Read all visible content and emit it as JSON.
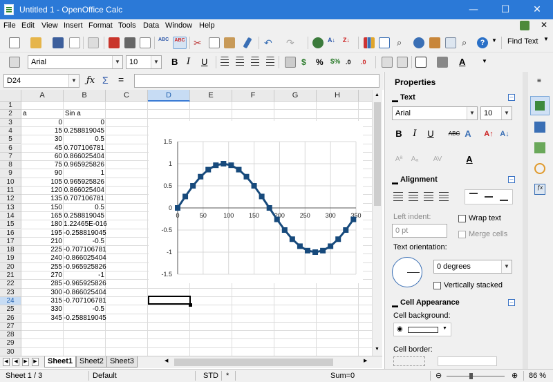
{
  "window": {
    "title": "Untitled 1 - OpenOffice Calc",
    "minimize_glyph": "—",
    "maximize_glyph": "☐",
    "close_glyph": "✕"
  },
  "menu": [
    {
      "label": "File"
    },
    {
      "label": "Edit"
    },
    {
      "label": "View"
    },
    {
      "label": "Insert"
    },
    {
      "label": "Format"
    },
    {
      "label": "Tools"
    },
    {
      "label": "Data"
    },
    {
      "label": "Window"
    },
    {
      "label": "Help"
    }
  ],
  "toolbar": {
    "find_text_label": "Find Text",
    "font_name": "Arial",
    "font_size": "10"
  },
  "formula_bar": {
    "name_box": "D24",
    "formula": ""
  },
  "grid": {
    "columns": [
      "A",
      "B",
      "C",
      "D",
      "E",
      "F",
      "G",
      "H"
    ],
    "active_column": "D",
    "rows": [
      "1",
      "2",
      "3",
      "4",
      "5",
      "6",
      "7",
      "8",
      "9",
      "10",
      "11",
      "12",
      "13",
      "14",
      "15",
      "16",
      "17",
      "18",
      "19",
      "20",
      "21",
      "22",
      "23",
      "24",
      "25",
      "26",
      "27",
      "28",
      "29",
      "30"
    ],
    "active_row": "24",
    "header_a": "a",
    "header_b": "Sin a",
    "data": [
      [
        "0",
        "0"
      ],
      [
        "15",
        "0.258819045"
      ],
      [
        "30",
        "0.5"
      ],
      [
        "45",
        "0.707106781"
      ],
      [
        "60",
        "0.866025404"
      ],
      [
        "75",
        "0.965925826"
      ],
      [
        "90",
        "1"
      ],
      [
        "105",
        "0.965925826"
      ],
      [
        "120",
        "0.866025404"
      ],
      [
        "135",
        "0.707106781"
      ],
      [
        "150",
        "0.5"
      ],
      [
        "165",
        "0.258819045"
      ],
      [
        "180",
        "1.22465E-016"
      ],
      [
        "195",
        "-0.258819045"
      ],
      [
        "210",
        "-0.5"
      ],
      [
        "225",
        "-0.707106781"
      ],
      [
        "240",
        "-0.866025404"
      ],
      [
        "255",
        "-0.965925826"
      ],
      [
        "270",
        "-1"
      ],
      [
        "285",
        "-0.965925826"
      ],
      [
        "300",
        "-0.866025404"
      ],
      [
        "315",
        "-0.707106781"
      ],
      [
        "330",
        "-0.5"
      ],
      [
        "345",
        "-0.258819045"
      ]
    ]
  },
  "chart_data": {
    "type": "line",
    "title": "",
    "xlabel": "",
    "ylabel": "",
    "x": [
      0,
      15,
      30,
      45,
      60,
      75,
      90,
      105,
      120,
      135,
      150,
      165,
      180,
      195,
      210,
      225,
      240,
      255,
      270,
      285,
      300,
      315,
      330,
      345
    ],
    "series": [
      {
        "values": [
          0,
          0.258819045,
          0.5,
          0.707106781,
          0.866025404,
          0.965925826,
          1,
          0.965925826,
          0.866025404,
          0.707106781,
          0.5,
          0.258819045,
          0,
          -0.258819045,
          -0.5,
          -0.707106781,
          -0.866025404,
          -0.965925826,
          -1,
          -0.965925826,
          -0.866025404,
          -0.707106781,
          -0.5,
          -0.258819045
        ],
        "color": "#174a7c"
      }
    ],
    "xticks": [
      "0",
      "50",
      "100",
      "150",
      "200",
      "250",
      "300",
      "350"
    ],
    "yticks": [
      "1.5",
      "1",
      "0.5",
      "0",
      "-0.5",
      "-1",
      "-1.5"
    ],
    "xlim": [
      0,
      350
    ],
    "ylim": [
      -1.5,
      1.5
    ],
    "grid": true,
    "legend": "none"
  },
  "sheets": {
    "tabs": [
      "Sheet1",
      "Sheet2",
      "Sheet3"
    ],
    "active": "Sheet1"
  },
  "sidebar": {
    "title": "Properties",
    "text_section": "Text",
    "font_name": "Arial",
    "font_size": "10",
    "alignment_section": "Alignment",
    "left_indent_label": "Left indent:",
    "left_indent_value": "0 pt",
    "wrap_text_label": "Wrap text",
    "merge_cells_label": "Merge cells",
    "text_orientation_label": "Text orientation:",
    "orientation_value": "0 degrees",
    "vertically_stacked_label": "Vertically stacked",
    "cell_appearance_section": "Cell Appearance",
    "cell_background_label": "Cell background:",
    "cell_border_label": "Cell border:"
  },
  "status": {
    "sheet": "Sheet 1 / 3",
    "style": "Default",
    "mode": "STD",
    "modified": "*",
    "sum": "Sum=0",
    "zoom": "86 %"
  },
  "colors": {
    "titlebar": "#2b79d7",
    "accent": "#3a7bd5",
    "series": "#174a7c"
  }
}
